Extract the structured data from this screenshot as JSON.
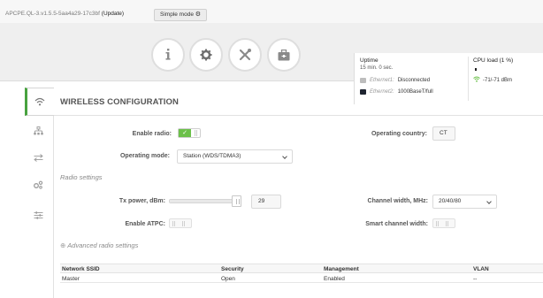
{
  "header": {
    "firmware": "APCPE.QL-3.v1.5.5-5aa4a29-17c3bf",
    "update_link": "(Update)",
    "simple_mode_label": "Simple mode"
  },
  "nav_icons": [
    "info-icon",
    "gear-icon",
    "tools-icon",
    "toolbox-icon"
  ],
  "status": {
    "uptime_label": "Uptime",
    "uptime_value": "15 min. 0 sec.",
    "cpu_label": "CPU load (1 %)",
    "cpu_load_percent": 1,
    "ethernet1_label": "Ethernet1:",
    "ethernet1_value": "Disconnected",
    "ethernet2_label": "Ethernet2:",
    "ethernet2_value": "1000BaseT/full",
    "signal_value": "-71/-71 dBm"
  },
  "sidebar": {
    "items": [
      "wifi-icon",
      "network-icon",
      "arrows-icon",
      "cogs-icon",
      "sliders-icon"
    ]
  },
  "page": {
    "title": "WIRELESS CONFIGURATION"
  },
  "form": {
    "enable_radio_label": "Enable radio:",
    "enable_radio_on": true,
    "operating_country_label": "Operating country:",
    "operating_country_value": "CT",
    "operating_mode_label": "Operating mode:",
    "operating_mode_value": "Station (WDS/TDMA3)",
    "radio_settings_title": "Radio settings",
    "tx_power_label": "Tx power, dBm:",
    "tx_power_value": "29",
    "channel_width_label": "Channel width, MHz:",
    "channel_width_value": "20/40/80",
    "enable_atpc_label": "Enable ATPC:",
    "smart_channel_label": "Smart channel width:",
    "advanced_label": "Advanced radio settings"
  },
  "table": {
    "headers": [
      "Network SSID",
      "Security",
      "Management",
      "VLAN"
    ],
    "rows": [
      [
        "Master",
        "Open",
        "Enabled",
        "--"
      ]
    ]
  },
  "colors": {
    "accent_green": "#6cc04a",
    "active_border": "#48a23f"
  }
}
